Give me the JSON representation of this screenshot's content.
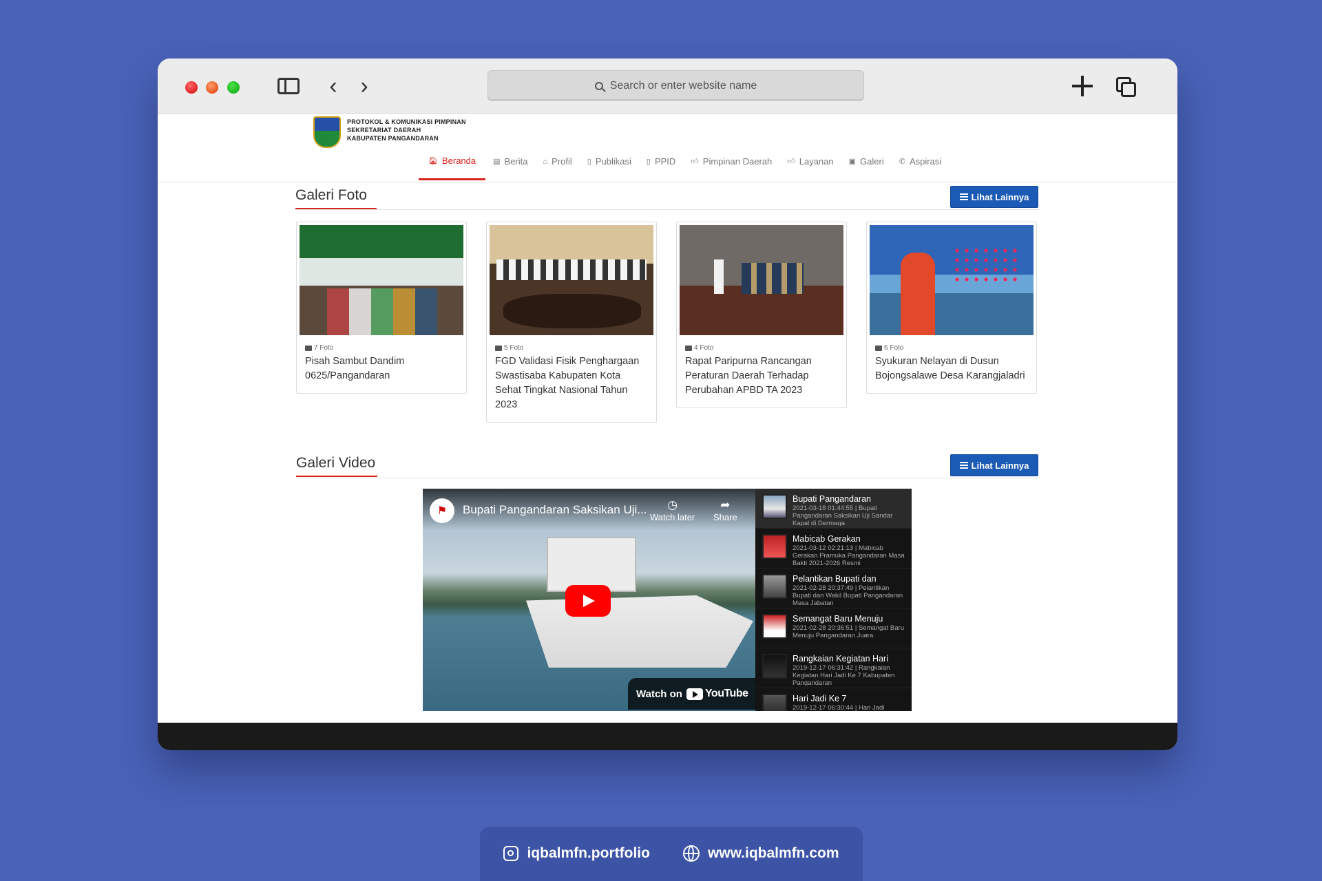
{
  "browser": {
    "url_placeholder": "Search or enter website name"
  },
  "site": {
    "org_lines": [
      "PROTOKOL & KOMUNIKASI PIMPINAN",
      "SEKRETARIAT DAERAH",
      "KABUPATEN PANGANDARAN"
    ],
    "nav": [
      {
        "label": "Beranda",
        "icon": "home-icon",
        "active": true
      },
      {
        "label": "Berita",
        "icon": "newspaper-icon"
      },
      {
        "label": "Profil",
        "icon": "building-icon"
      },
      {
        "label": "Publikasi",
        "icon": "document-icon"
      },
      {
        "label": "PPID",
        "icon": "file-icon"
      },
      {
        "label": "Pimpinan Daerah",
        "icon": "thumbs-up-icon"
      },
      {
        "label": "Layanan",
        "icon": "thumbs-up-icon"
      },
      {
        "label": "Galeri",
        "icon": "image-icon"
      },
      {
        "label": "Aspirasi",
        "icon": "phone-icon"
      }
    ]
  },
  "photo_gallery": {
    "title": "Galeri Foto",
    "more_label": "Lihat Lainnya",
    "cards": [
      {
        "count": "7 Foto",
        "title": "Pisah Sambut Dandim 0625/Pangandaran"
      },
      {
        "count": "5 Foto",
        "title": "FGD Validasi Fisik Penghargaan Swastisaba Kabupaten Kota Sehat Tingkat Nasional Tahun 2023"
      },
      {
        "count": "4 Foto",
        "title": "Rapat Paripurna Rancangan Peraturan Daerah Terhadap Perubahan APBD TA 2023"
      },
      {
        "count": "6 Foto",
        "title": "Syukuran Nelayan di Dusun Bojongsalawe Desa Karangjaladri"
      }
    ]
  },
  "video_gallery": {
    "title": "Galeri Video",
    "more_label": "Lihat Lainnya",
    "player": {
      "title": "Bupati Pangandaran Saksikan Uji...",
      "watch_later": "Watch later",
      "share": "Share",
      "watch_on": "Watch on",
      "brand": "YouTube"
    },
    "playlist": [
      {
        "title": "Bupati Pangandaran",
        "desc": "2021-03-18 01:44:55 | Bupati Pangandaran Saksikan Uji Sandar Kapal di Dermaga"
      },
      {
        "title": "Mabicab Gerakan",
        "desc": "2021-03-12 02:21:13 | Mabicab Gerakan Pramuka Pangandaran Masa Bakti 2021-2026 Resmi"
      },
      {
        "title": "Pelantikan Bupati dan",
        "desc": "2021-02-28 20:37:49 | Pelantikan Bupati dan Wakil Bupati Pangandaran Masa Jabatan"
      },
      {
        "title": "Semangat Baru Menuju",
        "desc": "2021-02-28 20:36:51 | Semangat Baru Menuju Pangandaran Juara"
      },
      {
        "title": "Rangkaian Kegiatan Hari",
        "desc": "2019-12-17 06:31:42 | Rangkaian Kegiatan Hari Jadi Ke 7 Kabupaten Pangandaran"
      },
      {
        "title": "Hari Jadi Ke 7",
        "desc": "2019-12-17 06:30:44 | Hari Jadi"
      }
    ]
  },
  "credits": {
    "instagram": "iqbalmfn.portfolio",
    "website": "www.iqbalmfn.com"
  }
}
